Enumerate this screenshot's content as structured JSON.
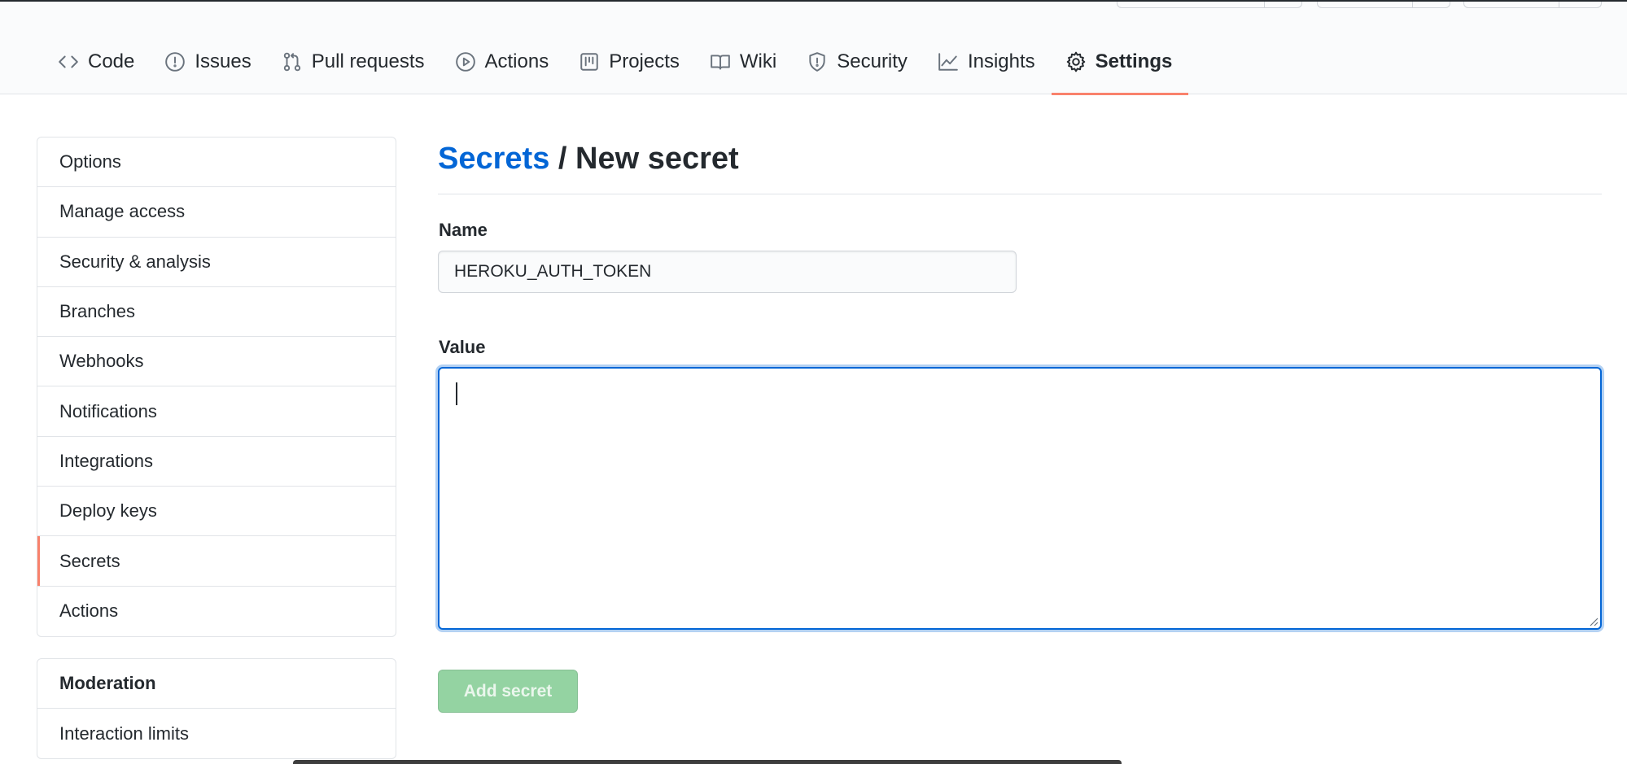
{
  "repo_nav": {
    "tabs": [
      {
        "label": "Code",
        "icon": "code-icon"
      },
      {
        "label": "Issues",
        "icon": "issue-opened-icon"
      },
      {
        "label": "Pull requests",
        "icon": "git-pull-request-icon"
      },
      {
        "label": "Actions",
        "icon": "play-icon"
      },
      {
        "label": "Projects",
        "icon": "project-icon"
      },
      {
        "label": "Wiki",
        "icon": "book-icon"
      },
      {
        "label": "Security",
        "icon": "shield-icon"
      },
      {
        "label": "Insights",
        "icon": "graph-icon"
      },
      {
        "label": "Settings",
        "icon": "gear-icon",
        "selected": true
      }
    ]
  },
  "sidebar": {
    "items": [
      {
        "label": "Options"
      },
      {
        "label": "Manage access"
      },
      {
        "label": "Security & analysis"
      },
      {
        "label": "Branches"
      },
      {
        "label": "Webhooks"
      },
      {
        "label": "Notifications"
      },
      {
        "label": "Integrations"
      },
      {
        "label": "Deploy keys"
      },
      {
        "label": "Secrets",
        "selected": true
      },
      {
        "label": "Actions"
      }
    ],
    "moderation": {
      "heading": "Moderation",
      "items": [
        {
          "label": "Interaction limits"
        }
      ]
    }
  },
  "main": {
    "breadcrumb_link": "Secrets",
    "breadcrumb_separator": "/",
    "title": "New secret",
    "name_label": "Name",
    "name_value": "HEROKU_AUTH_TOKEN",
    "value_label": "Value",
    "value_text": "",
    "submit_label": "Add secret"
  },
  "colors": {
    "link": "#0366d6",
    "selected_underline": "#f9826c",
    "focus_border": "#0366d6",
    "disabled_button": "#94d3a2"
  }
}
